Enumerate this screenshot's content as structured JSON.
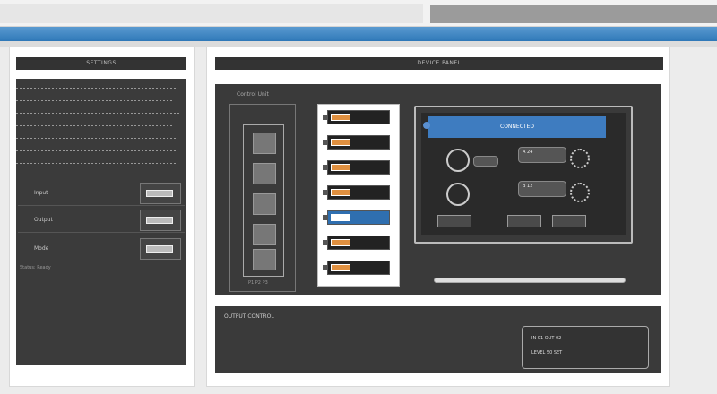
{
  "left_panel": {
    "title": "SETTINGS",
    "rows": [
      {
        "label": "Input"
      },
      {
        "label": "Output"
      },
      {
        "label": "Mode"
      }
    ],
    "footer": "Status: Ready"
  },
  "main_panel": {
    "title": "DEVICE PANEL",
    "section_label": "Control Unit",
    "presets": [
      "P1 P2 P3"
    ],
    "switches": [
      {
        "state": "off"
      },
      {
        "state": "off"
      },
      {
        "state": "off"
      },
      {
        "state": "off"
      },
      {
        "state": "on"
      },
      {
        "state": "off"
      },
      {
        "state": "off"
      }
    ],
    "screen": {
      "title": "CONNECTED",
      "pill_a": "A 24",
      "pill_b": "B 12"
    },
    "bottom": {
      "label": "OUTPUT CONTROL",
      "box_line1": "IN 01   OUT 02",
      "box_line2": "LEVEL 50   SET"
    }
  },
  "colors": {
    "accent": "#3e7cc0",
    "toggle": "#e09040"
  }
}
